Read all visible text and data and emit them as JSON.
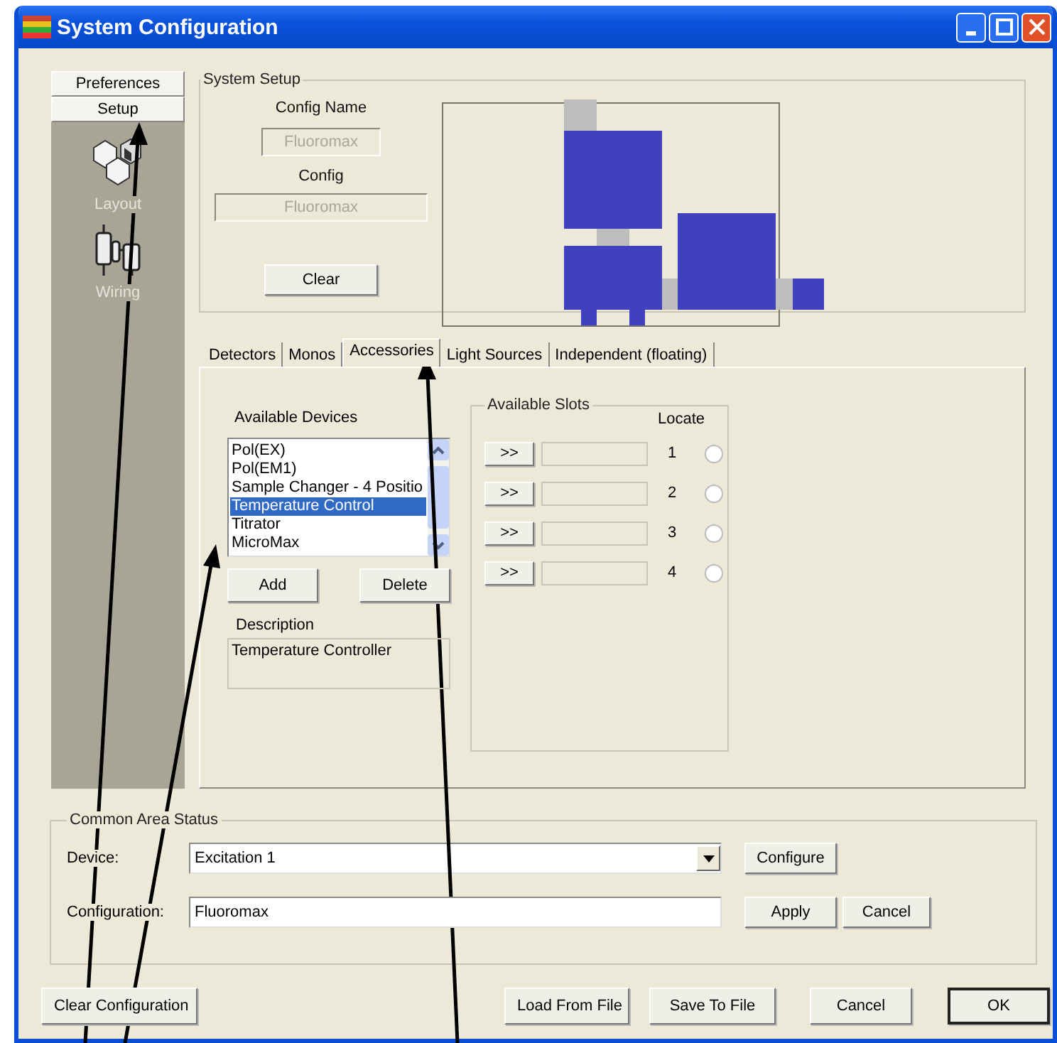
{
  "window": {
    "title": "System Configuration"
  },
  "sidebar": {
    "buttons": [
      {
        "label": "Preferences"
      },
      {
        "label": "Setup"
      }
    ],
    "items": [
      {
        "label": "Layout",
        "kind": "cubes"
      },
      {
        "label": "Wiring",
        "kind": "plugs"
      }
    ]
  },
  "system_setup": {
    "title": "System Setup",
    "config_name_label": "Config Name",
    "config_name": "Fluoromax",
    "config_label": "Config",
    "config": "Fluoromax",
    "disabled": true,
    "clear_button": "Clear"
  },
  "tabs": [
    {
      "label": "Detectors",
      "selected": false
    },
    {
      "label": "Monos",
      "selected": false
    },
    {
      "label": "Accessories",
      "selected": true
    },
    {
      "label": "Light Sources",
      "selected": false
    },
    {
      "label": "Independent (floating)",
      "selected": false
    }
  ],
  "devices": {
    "label": "Available Devices",
    "items": [
      {
        "label": "Pol(EX)",
        "selected": false
      },
      {
        "label": "Pol(EM1)",
        "selected": false
      },
      {
        "label": "Sample Changer - 4 Positio",
        "selected": false
      },
      {
        "label": "Temperature Control",
        "selected": true
      },
      {
        "label": "Titrator",
        "selected": false
      },
      {
        "label": "MicroMax",
        "selected": false
      }
    ],
    "add_button": "Add",
    "delete_button": "Delete",
    "description_label": "Description",
    "description": "Temperature Controller"
  },
  "slots": {
    "title": "Available Slots",
    "locate_label": "Locate",
    "rows": [
      {
        "button": ">>",
        "number": "1",
        "selected": false
      },
      {
        "button": ">>",
        "number": "2",
        "selected": false
      },
      {
        "button": ">>",
        "number": "3",
        "selected": false
      },
      {
        "button": ">>",
        "number": "4",
        "selected": false
      }
    ]
  },
  "common_area": {
    "title": "Common Area Status",
    "device_label": "Device:",
    "device": "Excitation 1",
    "configure_button": "Configure",
    "configuration_label": "Configuration:",
    "configuration": "Fluoromax",
    "apply_button": "Apply",
    "cancel_button": "Cancel"
  },
  "buttons": [
    {
      "label": "Clear Configuration",
      "default": false
    },
    {
      "label": "Load From File",
      "default": false
    },
    {
      "label": "Save To File",
      "default": false
    },
    {
      "label": "Cancel",
      "default": false
    },
    {
      "label": "OK",
      "default": true
    }
  ]
}
